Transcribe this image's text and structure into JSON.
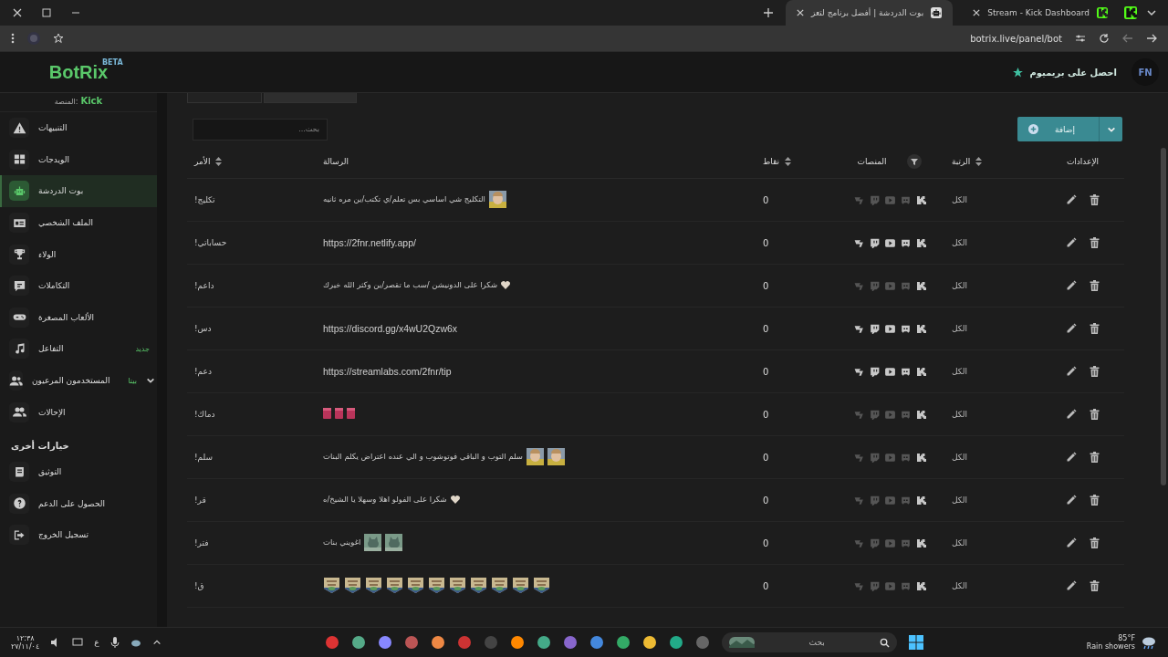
{
  "browser": {
    "tabs": [
      {
        "title": "Stream - Kick Dashboard",
        "selected": false
      },
      {
        "title": "بوت الدردشة | أفضل برنامج لتعز",
        "selected": true
      }
    ],
    "address": "botrix.live/panel/bot"
  },
  "header": {
    "logo": "BotRix",
    "logo_badge": "BETA",
    "premium": "احصل على بريميوم",
    "avatar": "FN"
  },
  "sidebar": {
    "platform_label": "المنصة:",
    "platform": "Kick",
    "items": [
      {
        "label": "التنبيهات",
        "selected": false
      },
      {
        "label": "الويدجات",
        "selected": false
      },
      {
        "label": "بوت الدردشة",
        "selected": true
      },
      {
        "label": "الملف الشخصي",
        "selected": false
      },
      {
        "label": "الولاء",
        "selected": false
      },
      {
        "label": "التكاملات",
        "selected": false
      },
      {
        "label": "الألعاب المصغرة",
        "selected": false
      },
      {
        "label": "التفاعل",
        "selected": false,
        "badge": "جديد"
      },
      {
        "label": "المستخدمون المرعيون",
        "selected": false,
        "badge": "بيتا",
        "expandable": true
      },
      {
        "label": "الإحالات",
        "selected": false
      }
    ],
    "section_title": "خيارات أخرى",
    "other_items": [
      {
        "label": "التوثيق"
      },
      {
        "label": "الحصول على الدعم"
      },
      {
        "label": "تسجيل الخروج"
      }
    ]
  },
  "search": {
    "placeholder": "بحث..."
  },
  "add_button": "إضافة",
  "table": {
    "columns": [
      "الإعدادات",
      "الرتبة",
      "المنصات",
      "نقاط",
      "الرسالة",
      "الأمر"
    ],
    "rows": [
      {
        "command": "!تكليج",
        "message": [
          {
            "kind": "face"
          },
          {
            "kind": "text",
            "text": "التكليج شي اساسي بس تعلم/ي تكتب/ين مره ثانيه"
          }
        ],
        "points": "0",
        "all_platforms": false,
        "rank": "الكل"
      },
      {
        "command": "!حساباتي",
        "message": [
          {
            "kind": "link",
            "text": "https://2fnr.netlify.app/"
          }
        ],
        "points": "0",
        "all_platforms": true,
        "rank": "الكل"
      },
      {
        "command": "!داعم",
        "message": [
          {
            "kind": "heart"
          },
          {
            "kind": "text",
            "text": "شكرا على الدونيشن /سب ما تقصر/ين وكثر الله خيرك"
          }
        ],
        "points": "0",
        "all_platforms": false,
        "rank": "الكل"
      },
      {
        "command": "!دس",
        "message": [
          {
            "kind": "link",
            "text": "https://discord.gg/x4wU2Qzw6x"
          }
        ],
        "points": "0",
        "all_platforms": true,
        "rank": "الكل"
      },
      {
        "command": "!دعم",
        "message": [
          {
            "kind": "link",
            "text": "https://streamlabs.com/2fnr/tip"
          }
        ],
        "points": "0",
        "all_platforms": true,
        "rank": "الكل"
      },
      {
        "command": "!دماك",
        "message": [
          {
            "kind": "gift"
          },
          {
            "kind": "gift"
          },
          {
            "kind": "gift"
          }
        ],
        "points": "0",
        "all_platforms": false,
        "rank": "الكل"
      },
      {
        "command": "!سلم",
        "message": [
          {
            "kind": "face"
          },
          {
            "kind": "face"
          },
          {
            "kind": "text",
            "text": "سلم التوب و الباقي فوتوشوب و الي عنده اعتراض يكلم البنات"
          }
        ],
        "points": "0",
        "all_platforms": false,
        "rank": "الكل"
      },
      {
        "command": "!قر",
        "message": [
          {
            "kind": "heart"
          },
          {
            "kind": "text",
            "text": "شكرا على الفولو اهلا وسهلا يا الشيخ/ه"
          }
        ],
        "points": "0",
        "all_platforms": false,
        "rank": "الكل"
      },
      {
        "command": "!فتر",
        "message": [
          {
            "kind": "cat"
          },
          {
            "kind": "cat"
          },
          {
            "kind": "text",
            "text": "اغويني بنات"
          }
        ],
        "points": "0",
        "all_platforms": false,
        "rank": "الكل"
      },
      {
        "command": "!ق",
        "message": [
          {
            "kind": "badge"
          },
          {
            "kind": "badge"
          },
          {
            "kind": "badge"
          },
          {
            "kind": "badge"
          },
          {
            "kind": "badge"
          },
          {
            "kind": "badge"
          },
          {
            "kind": "badge"
          },
          {
            "kind": "badge"
          },
          {
            "kind": "badge"
          },
          {
            "kind": "badge"
          },
          {
            "kind": "badge"
          }
        ],
        "points": "0",
        "all_platforms": false,
        "rank": "الكل"
      }
    ]
  },
  "taskbar": {
    "search_placeholder": "بحث",
    "weather_temp": "85°F",
    "weather_text": "Rain showers",
    "language": "ع",
    "time": "١٢:٣٨",
    "date": "٢٧/١١/٠٤"
  }
}
